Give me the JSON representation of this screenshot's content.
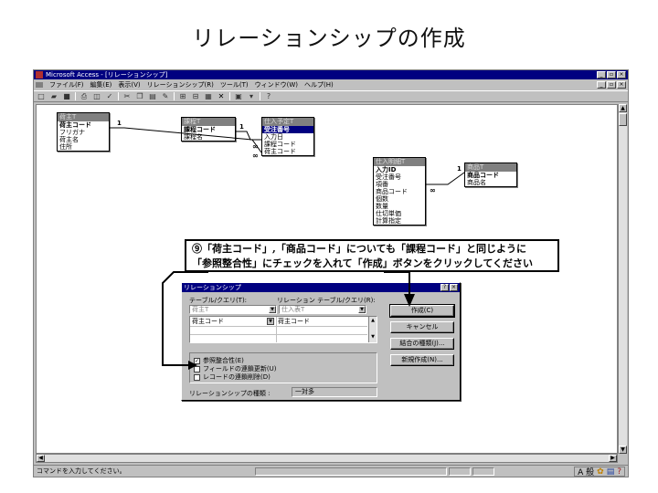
{
  "slide": {
    "title": "リレーションシップの作成"
  },
  "window": {
    "title": "Microsoft Access - [リレーションシップ]"
  },
  "menu": [
    "ファイル(F)",
    "編集(E)",
    "表示(V)",
    "リレーションシップ(R)",
    "ツール(T)",
    "ウィンドウ(W)",
    "ヘルプ(H)"
  ],
  "toolbar_icons": [
    "new-icon",
    "open-icon",
    "save-icon",
    "print-icon",
    "preview-icon",
    "spell-icon",
    "cut-icon",
    "copy-icon",
    "paste-icon",
    "format-painter-icon",
    "show-table-icon",
    "show-direct-icon",
    "show-all-icon",
    "delete-icon",
    "database-window-icon",
    "new-object-icon",
    "help-icon"
  ],
  "tables": {
    "niushu": {
      "title": "荷主T",
      "fields": [
        "荷主コード",
        "フリガナ",
        "荷主名",
        "住所"
      ]
    },
    "katei": {
      "title": "課程T",
      "fields": [
        "課程コード",
        "課程名"
      ]
    },
    "shiire_yotei": {
      "title": "仕入予定T",
      "fields": [
        "受注番号",
        "入力日",
        "課程コード",
        "荷主コード"
      ]
    },
    "shiire_meisai": {
      "title": "仕入明細T",
      "fields": [
        "入力ID",
        "受注番号",
        "項番",
        "商品コード",
        "個数",
        "数量",
        "仕切単価",
        "計算指定"
      ]
    },
    "shohin": {
      "title": "商品T",
      "fields": [
        "商品コード",
        "商品名"
      ]
    }
  },
  "relation_labels": {
    "one": "1",
    "many": "∞"
  },
  "callout": {
    "line1": "⑨「荷主コード」,「商品コード」についても「課程コード」と同じように",
    "line2": "「参照整合性」にチェックを入れて「作成」ボタンをクリックしてください"
  },
  "dialog": {
    "title": "リレーションシップ",
    "help_btn": "?",
    "close_btn": "×",
    "table_label": "テーブル/クエリ(T):",
    "related_label": "リレーション テーブル/クエリ(R):",
    "table_value": "荷主T",
    "related_value": "仕入表T",
    "field_left": "荷主コード",
    "field_right": "荷主コード",
    "buttons": {
      "create": "作成(C)",
      "cancel": "キャンセル",
      "join": "結合の種類(J)...",
      "new": "新規作成(N)..."
    },
    "checkboxes": [
      {
        "label": "参照整合性(E)",
        "checked": true
      },
      {
        "label": "フィールドの連鎖更新(U)",
        "checked": false
      },
      {
        "label": "レコードの連鎖削除(D)",
        "checked": false
      }
    ],
    "type_label": "リレーションシップの種類 :",
    "type_value": "一対多"
  },
  "status": {
    "message": "コマンドを入力してください。"
  },
  "ime": {
    "mode": "A 般"
  }
}
